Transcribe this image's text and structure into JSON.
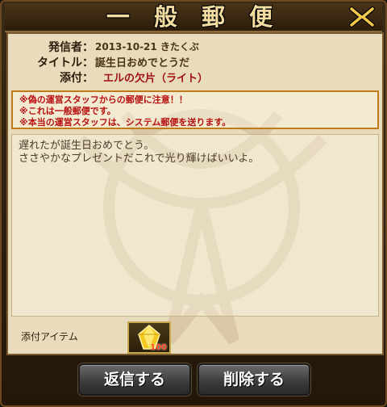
{
  "window": {
    "title": "一 般 郵 便"
  },
  "header": {
    "sender_label": "発信者：",
    "sender_value": "2013-10-21 きたくぶ",
    "subject_label": "タイトル：",
    "subject_value": "誕生日おめでとうだ",
    "attachment_label": "添付：",
    "attachment_value": "エルの欠片（ライト）"
  },
  "warning": {
    "lines": [
      "※偽の運営スタッフからの郵便に注意！！",
      "※これは一般郵便です。",
      "※本当の運営スタッフは、システム郵便を送ります。"
    ]
  },
  "body": {
    "lines": [
      "遅れたが誕生日おめでとう。",
      "ささやかなプレゼントだこれで光り輝けばいいよ。"
    ]
  },
  "attachment_item": {
    "label": "添付アイテム",
    "count": "100",
    "icon": "elrios-shard-light-icon"
  },
  "buttons": {
    "reply": "返信する",
    "delete": "削除する"
  },
  "colors": {
    "warning_text": "#b81010",
    "attachment_text": "#a01010",
    "title_text": "#f2dca0"
  }
}
